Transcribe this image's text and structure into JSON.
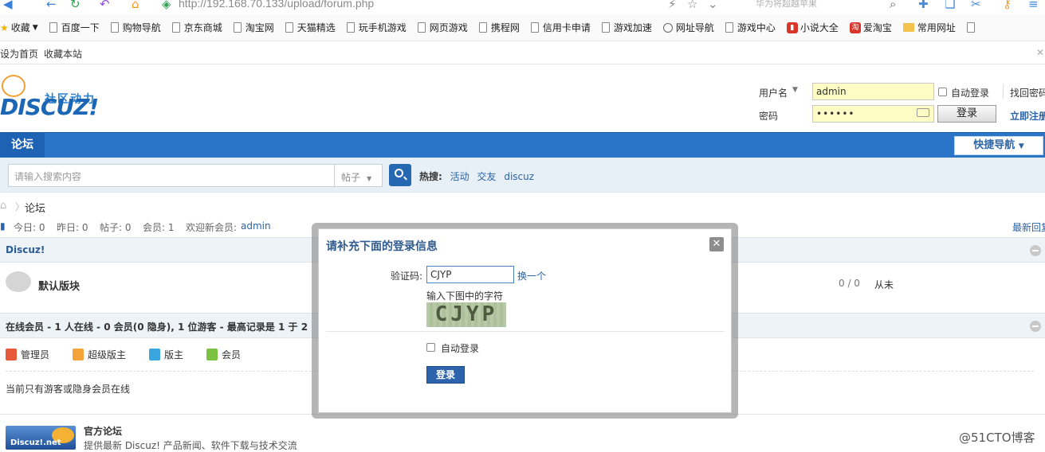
{
  "browser": {
    "url": "http://192.168.70.133/upload/forum.php",
    "search_placeholder": "华为将超越苹果"
  },
  "bookmarks": [
    "收藏",
    "百度一下",
    "购物导航",
    "京东商城",
    "淘宝网",
    "天猫精选",
    "玩手机游戏",
    "网页游戏",
    "携程网",
    "信用卡申请",
    "游戏加速",
    "网址导航",
    "游戏中心",
    "小说大全",
    "爱淘宝",
    "常用网址"
  ],
  "top_links": {
    "set_home": "设为首页",
    "add_fav": "收藏本站"
  },
  "logo": {
    "word": "DISCUZ!",
    "tagline": "社区动力"
  },
  "login": {
    "username_label": "用户名",
    "username_value": "admin",
    "password_label": "密码",
    "password_value": "••••••",
    "auto_login": "自动登录",
    "forgot": "找回密码",
    "register": "立即注册",
    "submit": "登录"
  },
  "nav": {
    "forum": "论坛",
    "quick_nav": "快捷导航"
  },
  "search": {
    "placeholder": "请输入搜索内容",
    "type": "帖子",
    "hot_label": "热搜:",
    "hot_items": [
      "活动",
      "交友",
      "discuz"
    ]
  },
  "breadcrumb": {
    "current": "论坛"
  },
  "stats": {
    "today": "今日: 0",
    "yesterday": "昨日: 0",
    "posts": "帖子: 0",
    "members": "会员: 1",
    "welcome": "欢迎新会员:",
    "new_member": "admin",
    "latest": "最新回复"
  },
  "section": {
    "title": "Discuz!"
  },
  "forum": {
    "name": "默认版块",
    "counts": "0 / 0",
    "last": "从未"
  },
  "online": {
    "title": "在线会员 - 1 人在线 - 0 会员(0 隐身), 1 位游客 - 最高记录是 1 于 2",
    "legend": [
      "管理员",
      "超级版主",
      "版主",
      "会员"
    ],
    "note": "当前只有游客或隐身会员在线"
  },
  "footer": {
    "logo_text": "Discuz!.net",
    "title": "官方论坛",
    "desc": "提供最新 Discuz! 产品新闻、软件下载与技术交流",
    "watermark": "@51CTO博客"
  },
  "dialog": {
    "title": "请补充下面的登录信息",
    "captcha_label": "验证码:",
    "captcha_value": "CJYP",
    "refresh": "换一个",
    "hint": "输入下图中的字符",
    "captcha_image_text": "CJYP",
    "auto_login": "自动登录",
    "submit": "登录"
  },
  "colors": {
    "nav_blue": "#2b75c8",
    "link_blue": "#2a63a6",
    "input_yellow": "#fcfcc4"
  }
}
